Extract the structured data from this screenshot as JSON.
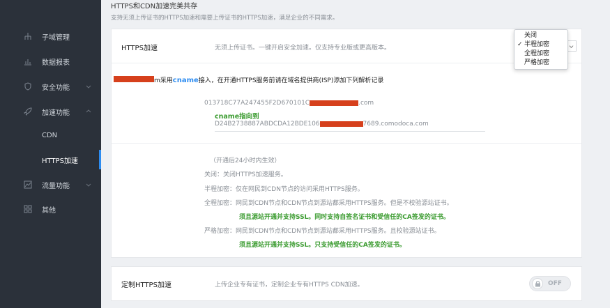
{
  "sidebar": {
    "items": [
      {
        "label": "子域管理",
        "icon": "sitemap-icon"
      },
      {
        "label": "数据报表",
        "icon": "bar-chart-icon"
      },
      {
        "label": "安全功能",
        "icon": "shield-icon"
      },
      {
        "label": "加速功能",
        "icon": "rocket-icon"
      },
      {
        "label": "CDN"
      },
      {
        "label": "HTTPS加速"
      },
      {
        "label": "流量功能",
        "icon": "image-chart-icon"
      },
      {
        "label": "其他",
        "icon": "grid-icon"
      }
    ]
  },
  "header": {
    "title": "HTTPS和CDN加速完美共存",
    "desc": "支持无须上传证书的HTTPS加速和需要上传证书的HTTPS加速，满足企业的不同需求。"
  },
  "https_row": {
    "label": "HTTPS加速",
    "desc": "无须上传证书。一键开启安全加速。仅支持专业版或更高版本。"
  },
  "dropdown": {
    "options": [
      "关闭",
      "半程加密",
      "全程加密",
      "严格加密"
    ],
    "checked": "半程加密"
  },
  "cname": {
    "instruction_prefix": "m采用",
    "instruction_keyword": "cname",
    "instruction_suffix": "接入，在开通HTTPS服务前请在域名提供商(ISP)添加下列解析记录",
    "record_host_prefix": "013718C77A247455F2D670101C",
    "record_host_suffix": ".com",
    "point_to_label": "cname指向到",
    "record_target_prefix": "D24B2738887ABDCDA12BDE106",
    "record_target_suffix": "7689.comodoca.com"
  },
  "notes": {
    "effect": "（开通后24小时内生效）",
    "off": "关闭：关闭HTTPS加速服务。",
    "half": "半程加密：仅在网民到CDN节点的访问采用HTTPS服务。",
    "full": "全程加密：网民到CDN节点和CDN节点到源站都采用HTTPS服务。但是不校验源站证书。",
    "full_note": "须且源站开通并支持SSL。同时支持自签名证书和受信任的CA签发的证书。",
    "strict": "严格加密：网民到CDN节点和CDN节点到源站都采用HTTPS服务。且校验源站证书。",
    "strict_note": "须且源站开通并支持SSL。只支持受信任的CA签发的证书。"
  },
  "custom_row": {
    "label": "定制HTTPS加速",
    "desc": "上传企业专有证书，定制企业专有HTTPS CDN加速。",
    "toggle_label": "OFF"
  },
  "colors": {
    "sidebar_bg": "#2b313a",
    "accent": "#2d8cf0",
    "green": "#3a9b2f",
    "redaction": "#d6401c"
  }
}
